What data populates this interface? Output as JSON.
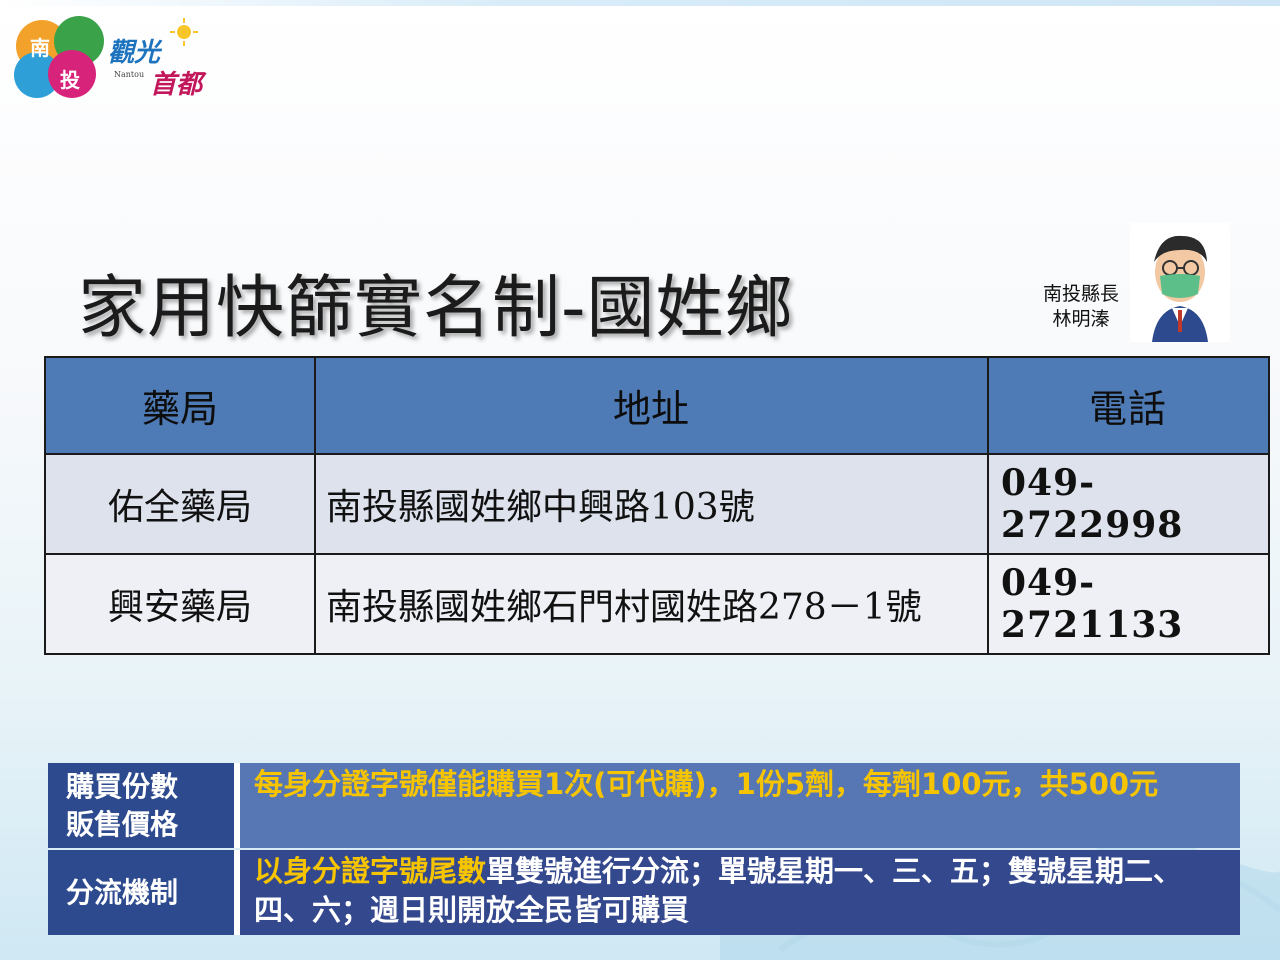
{
  "logo": {
    "text_main": "觀光",
    "text_sub": "首都",
    "text_en": "Nantou",
    "disc_chars": [
      "南",
      "投"
    ]
  },
  "title": "家用快篩實名制-國姓鄉",
  "mayor": {
    "line1": "南投縣長",
    "line2": "林明溱"
  },
  "table": {
    "headers": [
      "藥局",
      "地址",
      "電話"
    ],
    "rows": [
      {
        "name": "佑全藥局",
        "address": "南投縣國姓鄉中興路103號",
        "phone": "049-2722998"
      },
      {
        "name": "興安藥局",
        "address": "南投縣國姓鄉石門村國姓路278－1號",
        "phone": "049-2721133"
      }
    ]
  },
  "info": {
    "purchase_label_1": "購買份數",
    "purchase_label_2": "販售價格",
    "purchase_text": "每身分證字號僅能購買1次(可代購)，1份5劑，每劑100元，共500元",
    "split_label": "分流機制",
    "split_text_highlight": "以身分證字號尾數",
    "split_text_rest": "單雙號進行分流；單號星期一、三、五；雙號星期二、四、六；週日則開放全民皆可購買"
  },
  "colors": {
    "header_blue": "#4e7bb5",
    "label_navy": "#2e4a8e",
    "highlight_yellow": "#f6c400"
  }
}
